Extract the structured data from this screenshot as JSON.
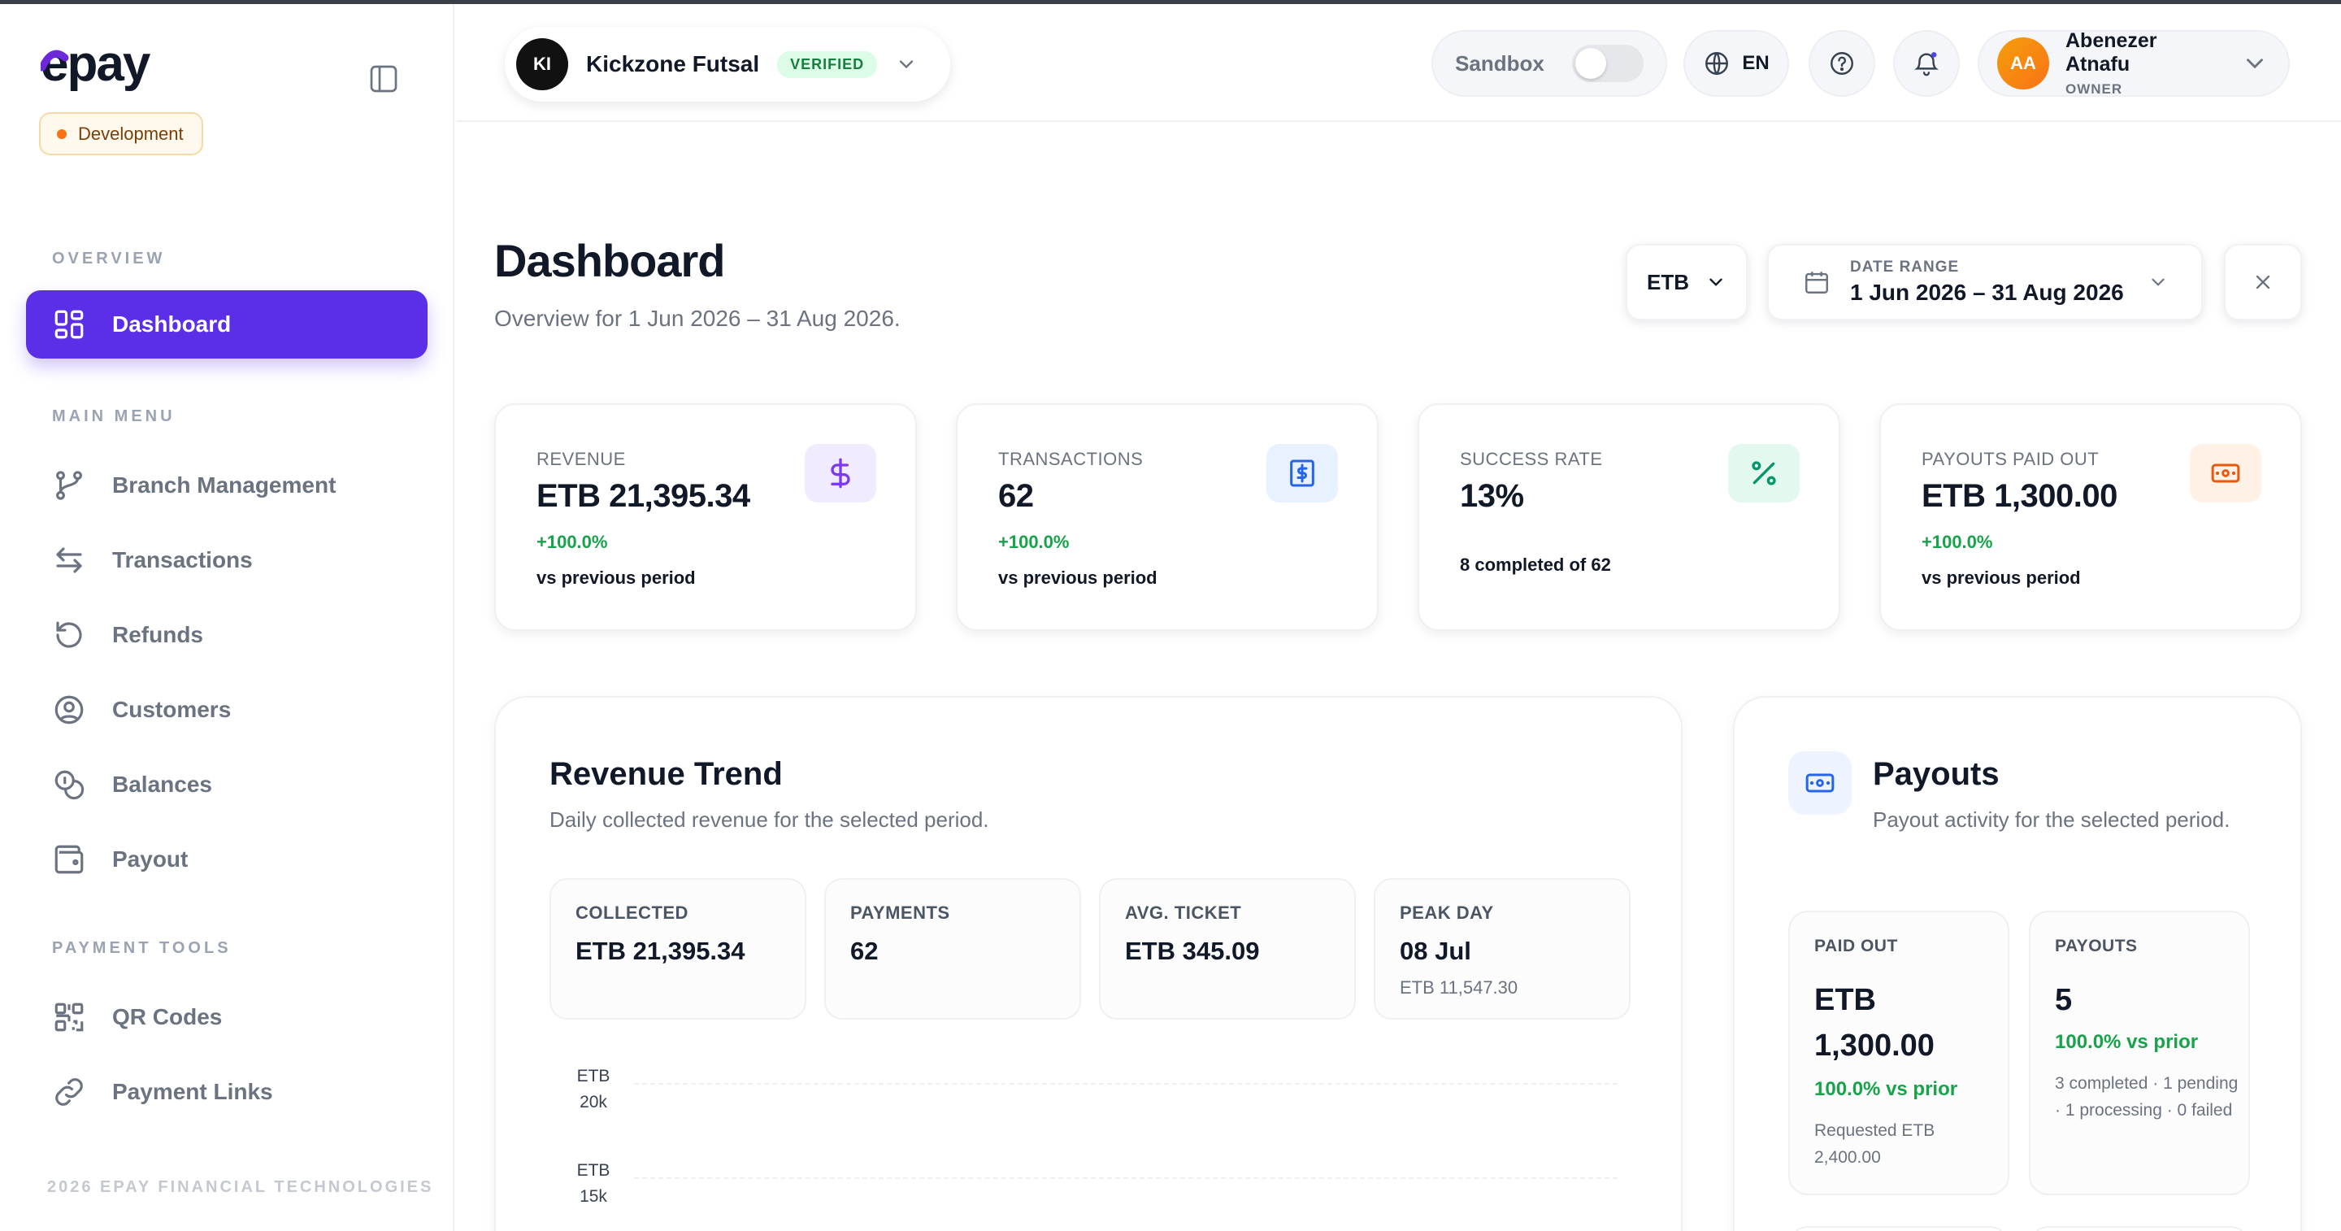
{
  "brand": {
    "name": "epay",
    "environment": "Development"
  },
  "sidebar": {
    "overview_label": "OVERVIEW",
    "main_menu_label": "MAIN MENU",
    "payment_tools_label": "PAYMENT TOOLS",
    "overview_items": [
      {
        "label": "Dashboard",
        "icon": "grid-icon",
        "active": true
      }
    ],
    "main_items": [
      {
        "label": "Branch Management",
        "icon": "branch-icon"
      },
      {
        "label": "Transactions",
        "icon": "arrows-icon"
      },
      {
        "label": "Refunds",
        "icon": "refund-icon"
      },
      {
        "label": "Customers",
        "icon": "user-circle-icon"
      },
      {
        "label": "Balances",
        "icon": "coins-icon"
      },
      {
        "label": "Payout",
        "icon": "wallet-icon"
      }
    ],
    "tool_items": [
      {
        "label": "QR Codes",
        "icon": "qr-icon"
      },
      {
        "label": "Payment Links",
        "icon": "link-icon"
      }
    ],
    "footer": "2026 EPAY FINANCIAL TECHNOLOGIES"
  },
  "header": {
    "business": {
      "initials": "KI",
      "name": "Kickzone Futsal",
      "status": "VERIFIED"
    },
    "sandbox_label": "Sandbox",
    "sandbox_on": false,
    "language": "EN",
    "user": {
      "initials": "AA",
      "name": "Abenezer Atnafu",
      "role": "OWNER"
    }
  },
  "page": {
    "title": "Dashboard",
    "subtitle": "Overview for 1 Jun 2026 – 31 Aug 2026.",
    "currency": "ETB",
    "date_range_label": "DATE RANGE",
    "date_range_value": "1 Jun 2026 – 31 Aug 2026"
  },
  "stats": [
    {
      "label": "REVENUE",
      "value": "ETB 21,395.34",
      "change": "+100.0%",
      "note": "vs previous period",
      "icon": "dollar-icon",
      "color": "#7c3aed"
    },
    {
      "label": "TRANSACTIONS",
      "value": "62",
      "change": "+100.0%",
      "note": "vs previous period",
      "icon": "receipt-icon",
      "color": "#2563eb"
    },
    {
      "label": "SUCCESS RATE",
      "value": "13%",
      "change": "",
      "note": "8 completed of 62",
      "icon": "percent-icon",
      "color": "#059669"
    },
    {
      "label": "PAYOUTS PAID OUT",
      "value": "ETB 1,300.00",
      "change": "+100.0%",
      "note": "vs previous period",
      "icon": "banknote-icon",
      "color": "#ea580c"
    }
  ],
  "revenue_trend": {
    "title": "Revenue Trend",
    "subtitle": "Daily collected revenue for the selected period.",
    "metrics": [
      {
        "label": "COLLECTED",
        "value": "ETB 21,395.34",
        "note": ""
      },
      {
        "label": "PAYMENTS",
        "value": "62",
        "note": ""
      },
      {
        "label": "AVG. TICKET",
        "value": "ETB 345.09",
        "note": ""
      },
      {
        "label": "PEAK DAY",
        "value": "08 Jul",
        "note": "ETB 11,547.30"
      }
    ],
    "y_ticks": [
      {
        "l1": "ETB",
        "l2": "20k"
      },
      {
        "l1": "ETB",
        "l2": "15k"
      }
    ]
  },
  "payouts": {
    "title": "Payouts",
    "subtitle": "Payout activity for the selected period.",
    "paid_out": {
      "label": "PAID OUT",
      "value": "ETB 1,300.00",
      "change": "100.0% vs prior",
      "note": "Requested ETB 2,400.00"
    },
    "count": {
      "label": "PAYOUTS",
      "value": "5",
      "change": "100.0% vs prior",
      "note": "3 completed · 1 pending · 1 processing · 0 failed"
    }
  }
}
